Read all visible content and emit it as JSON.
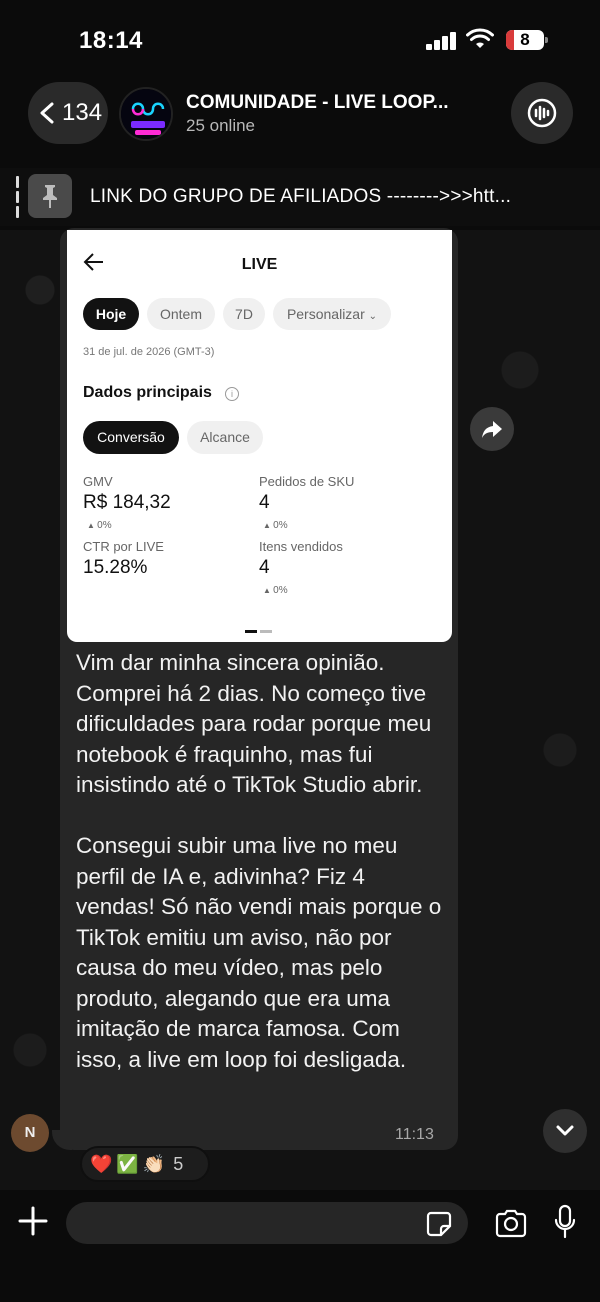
{
  "status_bar": {
    "time": "18:14",
    "battery": "8",
    "battery_color": "#d93b3b"
  },
  "header": {
    "back_count": "134",
    "group_name": "COMUNIDADE - LIVE LOOP...",
    "online": "25 online",
    "avatar_text": "Live Loop"
  },
  "pinned": {
    "text": "LINK DO GRUPO DE AFILIADOS -------->>>htt..."
  },
  "shared_screenshot": {
    "title": "LIVE",
    "chips": [
      "Hoje",
      "Ontem",
      "7D",
      "Personalizar"
    ],
    "date": "31 de jul. de 2026 (GMT-3)",
    "section": "Dados principais",
    "tabs": [
      "Conversão",
      "Alcance"
    ],
    "metrics": [
      {
        "label": "GMV",
        "value": "R$ 184,32",
        "delta": "0%"
      },
      {
        "label": "Pedidos de SKU",
        "value": "4",
        "delta": "0%"
      },
      {
        "label": "CTR por LIVE",
        "value": "15.28%"
      },
      {
        "label": "Itens vendidos",
        "value": "4",
        "delta": "0%"
      }
    ]
  },
  "message": {
    "paragraphs": [
      "Vim dar minha sincera opinião. Comprei há 2 dias. No começo tive dificuldades para rodar porque meu notebook é fraquinho, mas fui insistindo até o TikTok Studio abrir.",
      "Consegui subir uma live no meu perfil de IA e, adivinha? Fiz 4 vendas! Só não vendi mais porque o TikTok emitiu um aviso, não por causa do meu vídeo, mas pelo produto, alegando que era uma imitação de marca famosa. Com isso, a live em loop foi desligada."
    ],
    "time": "11:13",
    "sender_initial": "N",
    "reactions": {
      "emojis": [
        "❤️",
        "✅",
        "👏🏻"
      ],
      "count": "5"
    }
  },
  "composer": {
    "placeholder": ""
  },
  "colors": {
    "background": "#0b0b0b",
    "bubble": "#262626",
    "accent_chip": "#121212"
  }
}
